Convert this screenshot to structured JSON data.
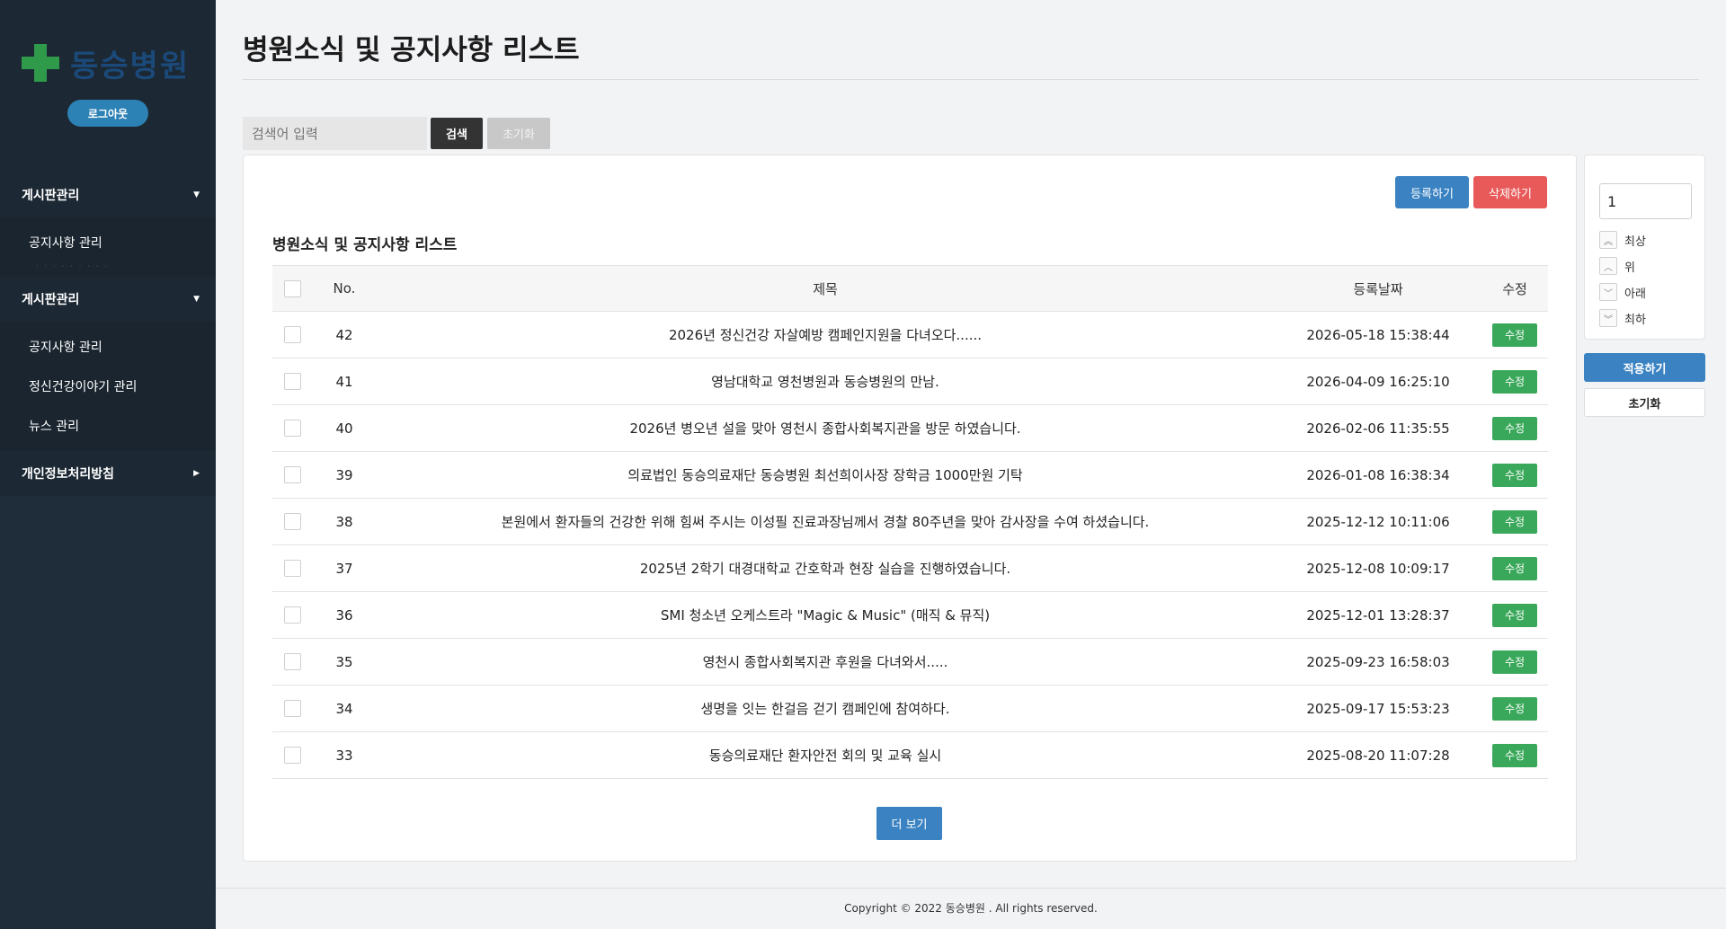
{
  "sidebar": {
    "logo_text": "동승병원",
    "logout_label": "로그아웃",
    "groups": [
      {
        "label": "게시판관리",
        "items": [
          "공지사항 관리"
        ]
      },
      {
        "label": "게시판관리",
        "items": [
          "공지사항 관리",
          "정신건강이야기 관리",
          "뉴스 관리"
        ]
      },
      {
        "label": "개인정보처리방침",
        "items": []
      }
    ]
  },
  "page": {
    "title": "병원소식 및 공지사항 리스트"
  },
  "search": {
    "placeholder": "검색어 입력",
    "search_label": "검색",
    "reset_label": "초기화"
  },
  "card": {
    "register_label": "등록하기",
    "delete_label": "삭제하기",
    "list_title": "병원소식 및 공지사항 리스트",
    "columns": {
      "no": "No.",
      "title": "제목",
      "date": "등록날짜",
      "edit": "수정"
    },
    "rows": [
      {
        "no": "42",
        "title": "2026년 정신건강 자살예방 캠페인지원을 다녀오다......",
        "date": "2026-05-18 15:38:44",
        "edit": "수정"
      },
      {
        "no": "41",
        "title": "영남대학교 영천병원과 동승병원의 만남.",
        "date": "2026-04-09 16:25:10",
        "edit": "수정"
      },
      {
        "no": "40",
        "title": "2026년 병오년 설을 맞아 영천시 종합사회복지관을 방문 하였습니다.",
        "date": "2026-02-06 11:35:55",
        "edit": "수정"
      },
      {
        "no": "39",
        "title": "의료법인 동승의료재단 동승병원 최선희이사장 장학금 1000만원 기탁",
        "date": "2026-01-08 16:38:34",
        "edit": "수정"
      },
      {
        "no": "38",
        "title": "본원에서 환자들의 건강한 위해 힘써 주시는 이성필 진료과장님께서 경찰 80주년을 맞아 감사장을 수여 하셨습니다.",
        "date": "2025-12-12 10:11:06",
        "edit": "수정"
      },
      {
        "no": "37",
        "title": "2025년 2학기 대경대학교 간호학과 현장 실습을 진행하였습니다.",
        "date": "2025-12-08 10:09:17",
        "edit": "수정"
      },
      {
        "no": "36",
        "title": "SMI 청소년 오케스트라 \"Magic & Music\" (매직 & 뮤직)",
        "date": "2025-12-01 13:28:37",
        "edit": "수정"
      },
      {
        "no": "35",
        "title": "영천시 종합사회복지관 후원을 다녀와서.....",
        "date": "2025-09-23 16:58:03",
        "edit": "수정"
      },
      {
        "no": "34",
        "title": "생명을 잇는 한걸음 걷기 캠페인에 참여하다.",
        "date": "2025-09-17 15:53:23",
        "edit": "수정"
      },
      {
        "no": "33",
        "title": "동승의료재단 환자안전 회의 및 교육 실시",
        "date": "2025-08-20 11:07:28",
        "edit": "수정"
      }
    ],
    "more_label": "더 보기"
  },
  "order_panel": {
    "value": "1",
    "options": [
      {
        "label": "최상",
        "icon": "double-chevron-up-icon",
        "glyph": "︽"
      },
      {
        "label": "위",
        "icon": "chevron-up-icon",
        "glyph": "︿"
      },
      {
        "label": "아래",
        "icon": "chevron-down-icon",
        "glyph": "﹀"
      },
      {
        "label": "최하",
        "icon": "double-chevron-down-icon",
        "glyph": "︾"
      }
    ],
    "apply_label": "적용하기",
    "reset_label": "초기화"
  },
  "footer": {
    "copyright": "Copyright © 2022 동승병원 . All rights reserved."
  },
  "colors": {
    "sidebar": "#1f2d3a",
    "primary": "#3a82c1",
    "danger": "#e85a5a",
    "success": "#3aa85a"
  }
}
